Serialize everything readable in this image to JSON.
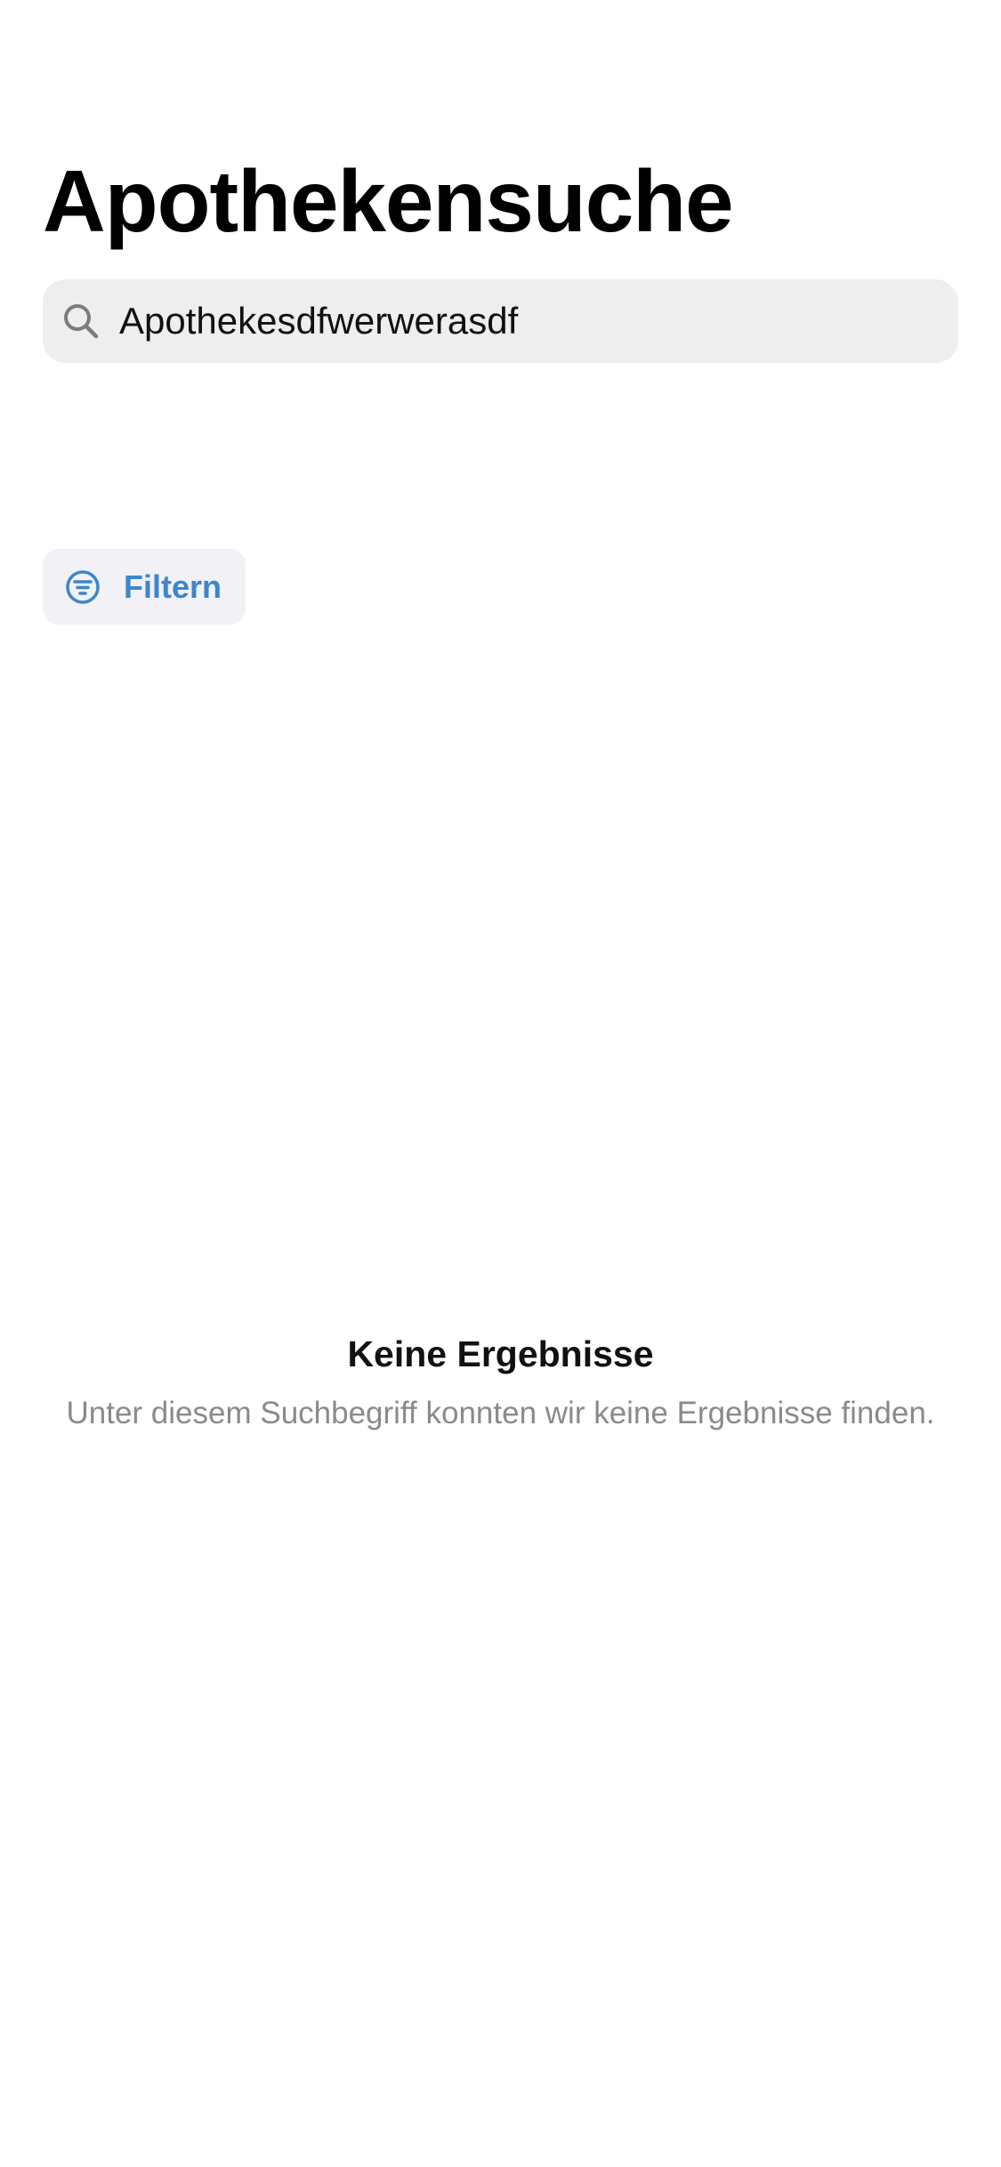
{
  "header": {
    "title": "Apothekensuche"
  },
  "search": {
    "icon": "search-icon",
    "value": "Apothekesdfwerwerasdf",
    "placeholder": ""
  },
  "filter": {
    "icon": "filter-icon",
    "label": "Filtern",
    "color": "#3d86cb"
  },
  "empty_state": {
    "title": "Keine Ergebnisse",
    "message": "Unter diesem Suchbegriff konnten wir keine Ergebnisse finden."
  }
}
